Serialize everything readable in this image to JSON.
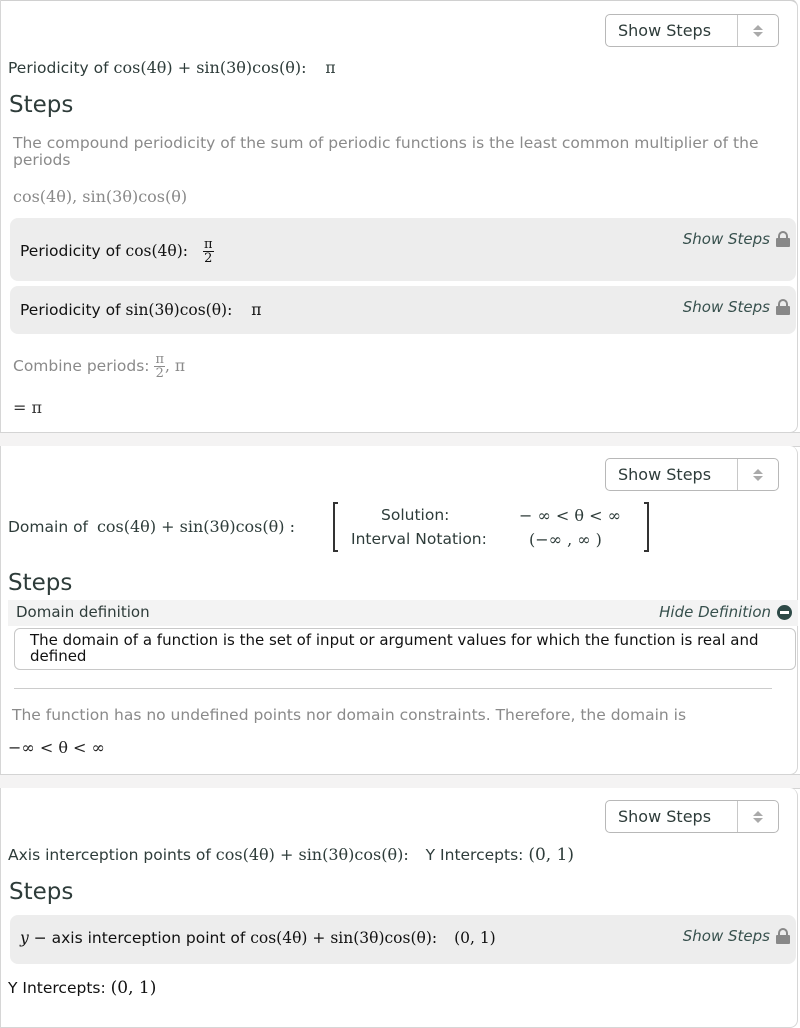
{
  "periodicity": {
    "select_label": "Show Steps",
    "title_prefix": "Periodicity of",
    "function": "cos(4θ) + sin(3θ)cos(θ):",
    "result": "π",
    "steps_heading": "Steps",
    "explanation": "The compound periodicity of the sum of periodic functions is the least common multiplier of the periods",
    "function_list": "cos(4θ), sin(3θ)cos(θ)",
    "substeps": [
      {
        "prefix": "Periodicity of",
        "function": "cos(4θ):",
        "result_num": "π",
        "result_den": "2",
        "action": "Show Steps"
      },
      {
        "prefix": "Periodicity of",
        "function": "sin(3θ)cos(θ):",
        "result": "π",
        "action": "Show Steps"
      }
    ],
    "combine_label": "Combine periods:",
    "combine_num": "π",
    "combine_den": "2",
    "combine_rest": ", π",
    "final": "= π"
  },
  "domain": {
    "select_label": "Show Steps",
    "title_prefix": "Domain of",
    "function": "cos(4θ) + sin(3θ)cos(θ) :",
    "solution_label": "Solution:",
    "solution_value": "− ∞  < θ < ∞",
    "interval_label": "Interval Notation:",
    "interval_value": "(−∞ , ∞ )",
    "steps_heading": "Steps",
    "definition_title": "Domain definition",
    "definition_toggle": "Hide Definition",
    "definition_text": "The domain of a function is the set of input or argument values for which the function is real and defined",
    "conclusion": "The function has no undefined points nor domain constraints.  Therefore,  the domain is",
    "final": "−∞  < θ < ∞"
  },
  "intercepts": {
    "select_label": "Show Steps",
    "title_prefix": "Axis interception points of",
    "function": "cos(4θ) + sin(3θ)cos(θ):",
    "result_label": "Y Intercepts:",
    "result_value": "(0, 1)",
    "steps_heading": "Steps",
    "substep": {
      "var": "y",
      "text": " − axis interception point of",
      "function": "cos(4θ) + sin(3θ)cos(θ):",
      "result": "(0, 1)",
      "action": "Show Steps"
    },
    "final_label": "Y Intercepts:",
    "final_value": "(0, 1)"
  }
}
